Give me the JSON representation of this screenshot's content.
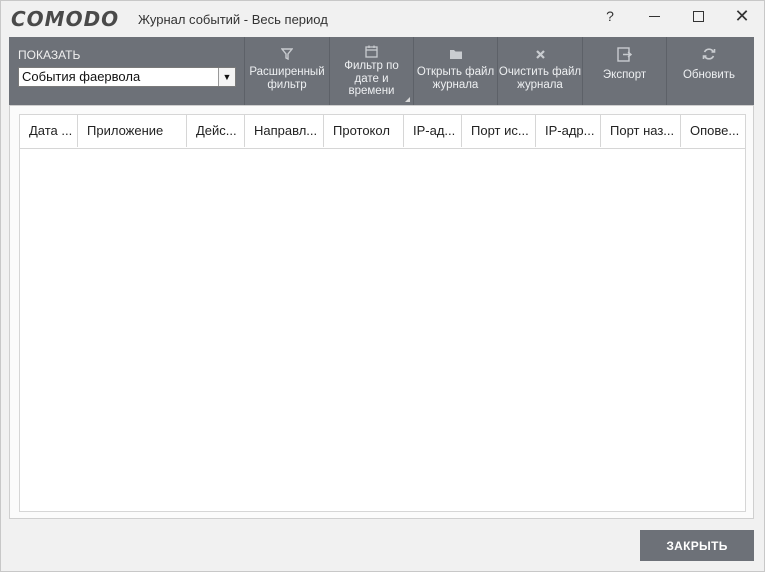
{
  "app": {
    "logo": "COMODO",
    "title": "Журнал событий - Весь период"
  },
  "window_controls": {
    "help": "?",
    "close": "✕"
  },
  "toolbar": {
    "show_label": "ПОКАЗАТЬ",
    "show_selected": "События фаервола",
    "buttons": [
      {
        "label": "Расширенный фильтр",
        "icon": "filter-icon"
      },
      {
        "label": "Фильтр по дате и времени",
        "icon": "calendar-icon"
      },
      {
        "label": "Открыть файл журнала",
        "icon": "folder-icon"
      },
      {
        "label": "Очистить файл журнала",
        "icon": "clear-icon"
      },
      {
        "label": "Экспорт",
        "icon": "export-icon"
      },
      {
        "label": "Обновить",
        "icon": "refresh-icon"
      }
    ]
  },
  "table": {
    "columns": [
      "Дата ...",
      "Приложение",
      "Дейс...",
      "Направл...",
      "Протокол",
      "IP-ад...",
      "Порт ис...",
      "IP-адр...",
      "Порт наз...",
      "Опове..."
    ],
    "rows": []
  },
  "footer": {
    "close_label": "ЗАКРЫТЬ"
  },
  "colors": {
    "toolbar_bg": "#6d7178",
    "window_bg": "#f1f1f1",
    "button_bg": "#6d7178"
  }
}
